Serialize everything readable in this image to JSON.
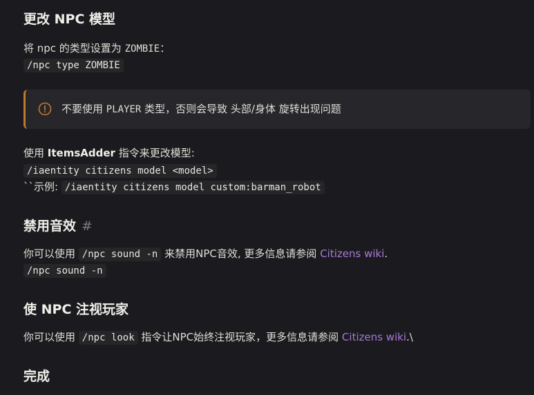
{
  "sections": {
    "model": {
      "title": "更改 NPC 模型",
      "line1_text": "将 npc 的类型设置为 ",
      "line1_code": "ZOMBIE",
      "line1_suffix": "：",
      "cmd": "/npc type ZOMBIE"
    },
    "warning": {
      "text_pre": "不要使用 ",
      "code": "PLAYER",
      "text_post": " 类型，否则会导致 头部/身体 旋转出现问题"
    },
    "itemsadder": {
      "text_pre": "使用 ",
      "strong": "ItemsAdder",
      "text_post": " 指令来更改模型:",
      "cmd": "/iaentity citizens model <model>",
      "example_label": "``示例: ",
      "example_cmd": "/iaentity citizens model custom:barman_robot"
    },
    "sound": {
      "title": "禁用音效",
      "anchor": "#",
      "text_pre": "你可以使用 ",
      "code": "/npc sound -n",
      "text_mid": " 来禁用NPC音效, 更多信息请参阅 ",
      "link": "Citizens wiki",
      "text_end": ".",
      "cmd": "/npc sound -n"
    },
    "look": {
      "title": "使 NPC 注视玩家",
      "text_pre": "你可以使用 ",
      "code": "/npc look",
      "text_mid": " 指令让NPC始终注视玩家，更多信息请参阅 ",
      "link": "Citizens wiki",
      "text_end": ".\\"
    },
    "done": {
      "title": "完成"
    }
  },
  "colors": {
    "background": "#1b1b1f",
    "link": "#a879d8",
    "warning_border": "#c07a2e"
  }
}
